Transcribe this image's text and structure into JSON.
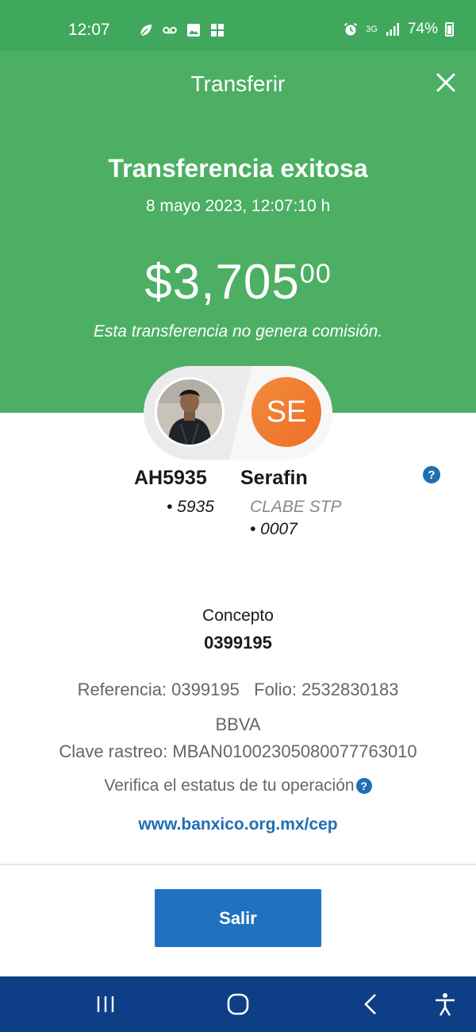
{
  "status_bar": {
    "time": "12:07",
    "network": "3G",
    "battery": "74%",
    "icons_left": [
      "leaf-icon",
      "voicemail-icon",
      "image-icon",
      "grid-icon"
    ],
    "icons_right": [
      "alarm-icon",
      "data-arrows-icon",
      "signal-icon",
      "battery-icon"
    ]
  },
  "header": {
    "title": "Transferir",
    "close_icon": "close-icon"
  },
  "receipt": {
    "status_title": "Transferencia exitosa",
    "datetime": "8 mayo 2023, 12:07:10 h",
    "amount_main": "$3,705",
    "amount_cents": "00",
    "fee_note": "Esta transferencia no genera comisión."
  },
  "sender": {
    "name": "AH5935",
    "account": "• 5935"
  },
  "recipient": {
    "initials": "SE",
    "name": "Serafin",
    "bank": "CLABE STP",
    "account": "• 0007"
  },
  "details": {
    "concept_label": "Concepto",
    "concept_value": "0399195",
    "reference": "Referencia: 0399195   Folio: 2532830183",
    "bank": "BBVA",
    "tracking": "Clave rastreo: MBAN01002305080077763010",
    "verify_text": "Verifica el estatus de tu operación",
    "verify_link": "www.banxico.org.mx/cep"
  },
  "actions": {
    "exit_label": "Salir"
  },
  "help_glyph": "?",
  "colors": {
    "status_bar": "#3fa85c",
    "hero": "#4caf64",
    "primary_blue": "#1f73be",
    "nav_bar": "#0e3f86",
    "avatar_orange": "#ef7630"
  }
}
